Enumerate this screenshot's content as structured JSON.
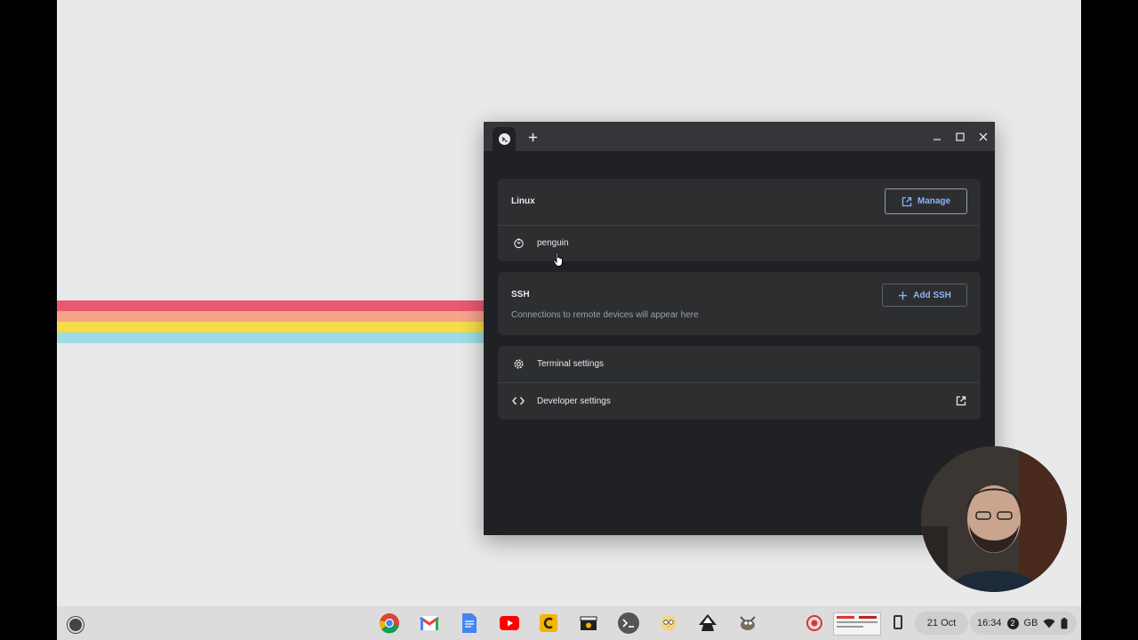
{
  "window": {
    "tab_icon": "terminal-tab-icon",
    "new_tab_icon": "plus-icon",
    "controls": [
      "minimize-icon",
      "maximize-icon",
      "close-icon"
    ]
  },
  "linux": {
    "header": "Linux",
    "manage_label": "Manage",
    "manage_icon": "open-external-icon",
    "container_name": "penguin",
    "container_icon": "penguin-status-icon"
  },
  "ssh": {
    "header": "SSH",
    "add_label": "Add SSH",
    "add_icon": "plus-icon",
    "empty_text": "Connections to remote devices will appear here"
  },
  "settings": {
    "terminal_label": "Terminal settings",
    "terminal_icon": "gear-icon",
    "developer_label": "Developer settings",
    "developer_icon": "code-icon",
    "developer_link_icon": "open-external-icon"
  },
  "shelf": {
    "apps": [
      "chrome-icon",
      "gmail-icon",
      "docs-icon",
      "youtube-icon",
      "app-c-icon",
      "clapper-icon",
      "terminal-icon",
      "owl-app-icon",
      "inkscape-icon",
      "gimp-icon"
    ],
    "date": "21 Oct",
    "notification_count": "2",
    "time": "16:34",
    "network_label": "GB"
  },
  "colors": {
    "accent": "#8ab4f8",
    "window_bg": "#202124",
    "card_bg": "#2d2e30"
  }
}
